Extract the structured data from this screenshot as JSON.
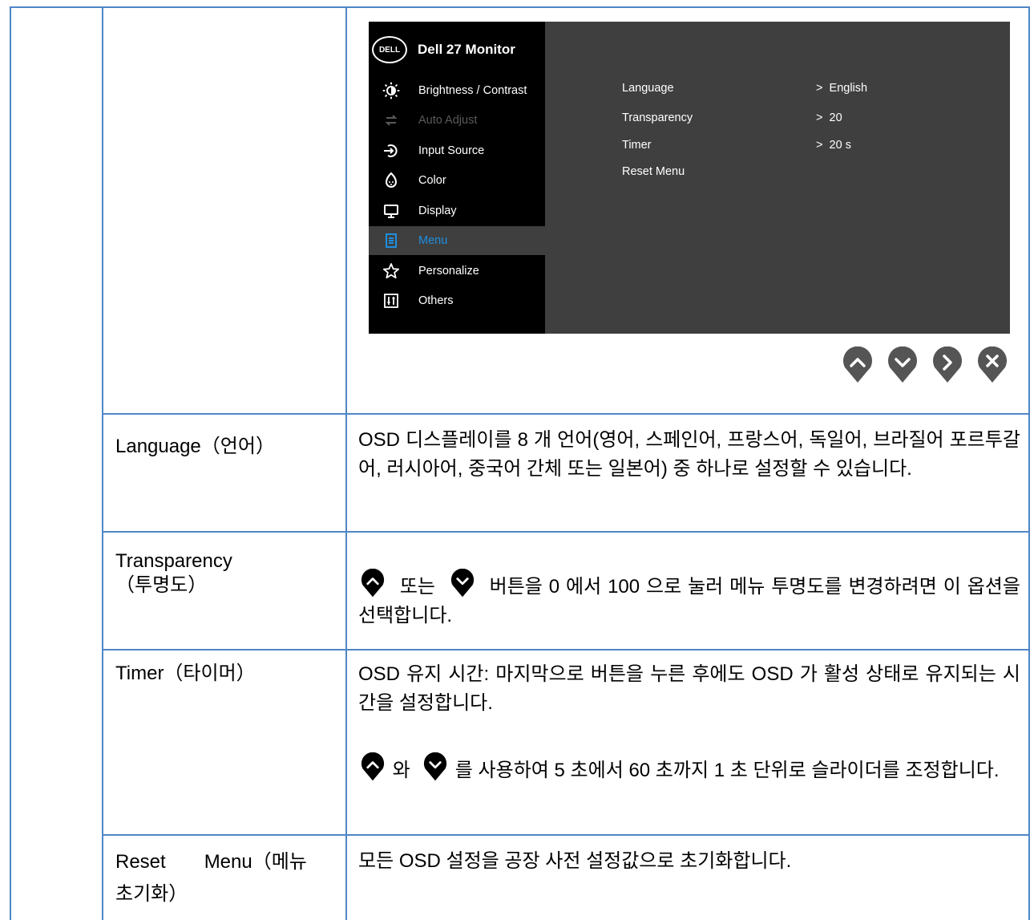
{
  "osd": {
    "title": "Dell 27 Monitor",
    "logo_text": "DELL",
    "menu_items": [
      {
        "label": "Brightness / Contrast",
        "icon": "brightness-icon",
        "state": "normal"
      },
      {
        "label": "Auto Adjust",
        "icon": "auto-adjust-icon",
        "state": "disabled"
      },
      {
        "label": "Input Source",
        "icon": "input-source-icon",
        "state": "normal"
      },
      {
        "label": "Color",
        "icon": "color-icon",
        "state": "normal"
      },
      {
        "label": "Display",
        "icon": "display-icon",
        "state": "normal"
      },
      {
        "label": "Menu",
        "icon": "menu-icon",
        "state": "active"
      },
      {
        "label": "Personalize",
        "icon": "star-icon",
        "state": "normal"
      },
      {
        "label": "Others",
        "icon": "others-icon",
        "state": "normal"
      }
    ],
    "submenu": [
      {
        "label": "Language",
        "value": "English"
      },
      {
        "label": "Transparency",
        "value": "20"
      },
      {
        "label": "Timer",
        "value": "20 s"
      },
      {
        "label": "Reset Menu",
        "value": ""
      }
    ],
    "value_prefix": ">",
    "nav_buttons": [
      "up-button",
      "down-button",
      "next-button",
      "exit-button"
    ]
  },
  "rows": {
    "language": {
      "label": "Language（언어）",
      "desc": "OSD 디스플레이를 8 개 언어(영어, 스페인어, 프랑스어, 독일어, 브라질어 포르투갈어, 러시아어, 중국어 간체 또는 일본어) 중 하나로 설정할 수 있습니다."
    },
    "transparency": {
      "label_line1": "Transparency",
      "label_line2": "（투명도）",
      "desc_part1": "또는",
      "desc_part2": "버튼을 0 에서 100 으로 눌러 메뉴 투명도를 변경하려면 이 옵션을 선택합니다."
    },
    "timer": {
      "label": "Timer（타이머）",
      "desc1": "OSD 유지 시간: 마지막으로 버튼을 누른 후에도 OSD 가 활성 상태로 유지되는 시간을 설정합니다.",
      "desc2_part1": "와",
      "desc2_part2": "를 사용하여 5 초에서 60 초까지 1 초 단위로 슬라이더를 조정합니다."
    },
    "reset": {
      "label_line1": "Reset　　Menu（메뉴",
      "label_line2": "초기화）",
      "desc": "모든 OSD 설정을 공장 사전 설정값으로 초기화합니다."
    }
  },
  "colors": {
    "table_border": "#4f86c6",
    "osd_sidebar": "#000000",
    "osd_panel": "#3f3f3f",
    "active_item": "#1e8fe0",
    "nav_button": "#555555"
  }
}
